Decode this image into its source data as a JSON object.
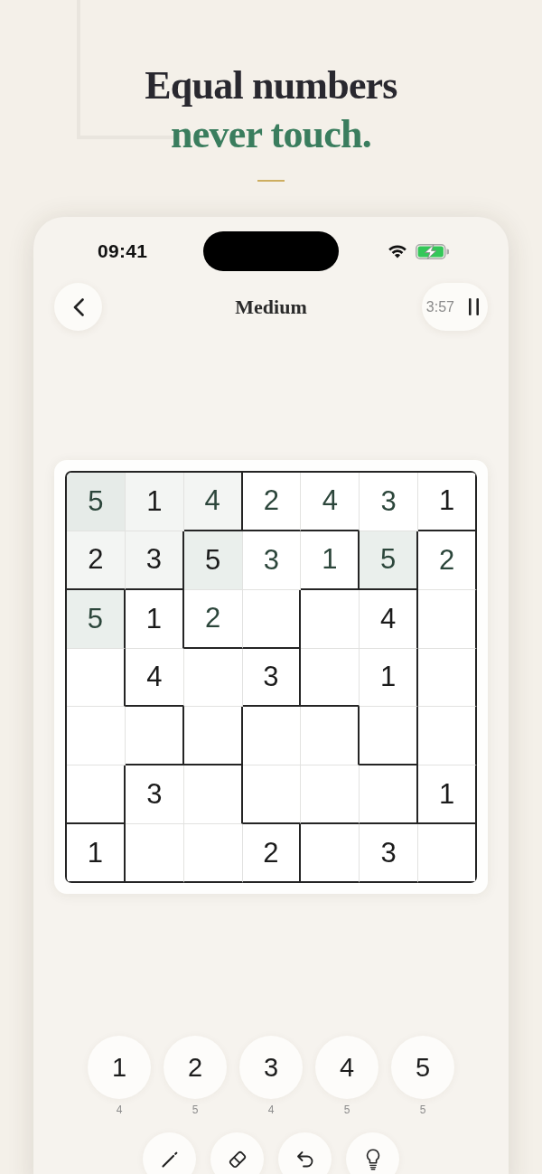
{
  "headline": {
    "line_1": "Equal numbers",
    "line_2": "never touch."
  },
  "status_bar": {
    "time": "09:41"
  },
  "nav": {
    "title": "Medium",
    "timer": "3:57"
  },
  "grid": {
    "rows": [
      [
        {
          "value": "5",
          "given": false,
          "same_number": true,
          "in_region": true,
          "wall_right": false,
          "wall_bottom": false
        },
        {
          "value": "1",
          "given": true,
          "same_number": false,
          "in_region": true,
          "wall_right": false,
          "wall_bottom": false
        },
        {
          "value": "4",
          "given": false,
          "same_number": false,
          "in_region": true,
          "wall_right": true,
          "wall_bottom": true
        },
        {
          "value": "2",
          "given": false,
          "same_number": false,
          "in_region": false,
          "wall_right": false,
          "wall_bottom": true
        },
        {
          "value": "4",
          "given": false,
          "same_number": false,
          "in_region": false,
          "wall_right": false,
          "wall_bottom": true
        },
        {
          "value": "3",
          "given": false,
          "same_number": false,
          "in_region": false,
          "wall_right": false,
          "wall_bottom": false
        },
        {
          "value": "1",
          "given": true,
          "same_number": false,
          "in_region": false,
          "wall_right": true,
          "wall_bottom": true
        }
      ],
      [
        {
          "value": "2",
          "given": true,
          "same_number": false,
          "in_region": true,
          "wall_right": false,
          "wall_bottom": true
        },
        {
          "value": "3",
          "given": true,
          "same_number": false,
          "in_region": true,
          "wall_right": true,
          "wall_bottom": true
        },
        {
          "value": "5",
          "given": true,
          "same_number": true,
          "in_region": false,
          "wall_right": false,
          "wall_bottom": false
        },
        {
          "value": "3",
          "given": false,
          "same_number": false,
          "in_region": false,
          "wall_right": false,
          "wall_bottom": false
        },
        {
          "value": "1",
          "given": false,
          "same_number": false,
          "in_region": false,
          "wall_right": true,
          "wall_bottom": true
        },
        {
          "value": "5",
          "given": false,
          "same_number": true,
          "in_region": false,
          "wall_right": true,
          "wall_bottom": true
        },
        {
          "value": "2",
          "given": false,
          "same_number": false,
          "in_region": false,
          "wall_right": true,
          "wall_bottom": false
        }
      ],
      [
        {
          "value": "5",
          "given": false,
          "same_number": true,
          "in_region": false,
          "wall_right": true,
          "wall_bottom": false
        },
        {
          "value": "1",
          "given": true,
          "same_number": false,
          "in_region": false,
          "wall_right": true,
          "wall_bottom": false
        },
        {
          "value": "2",
          "given": false,
          "same_number": false,
          "in_region": false,
          "wall_right": false,
          "wall_bottom": true
        },
        {
          "same_number": false,
          "in_region": false,
          "wall_right": true,
          "wall_bottom": true
        },
        {
          "same_number": false,
          "in_region": false,
          "wall_right": false,
          "wall_bottom": false
        },
        {
          "value": "4",
          "given": true,
          "same_number": false,
          "in_region": false,
          "wall_right": true,
          "wall_bottom": false
        },
        {
          "same_number": false,
          "in_region": false,
          "wall_right": true,
          "wall_bottom": false
        }
      ],
      [
        {
          "same_number": false,
          "in_region": false,
          "wall_right": true,
          "wall_bottom": false
        },
        {
          "value": "4",
          "given": true,
          "same_number": false,
          "in_region": false,
          "wall_right": false,
          "wall_bottom": true
        },
        {
          "same_number": false,
          "in_region": false,
          "wall_right": false,
          "wall_bottom": false
        },
        {
          "value": "3",
          "given": true,
          "same_number": false,
          "in_region": false,
          "wall_right": true,
          "wall_bottom": true
        },
        {
          "same_number": false,
          "in_region": false,
          "wall_right": false,
          "wall_bottom": true
        },
        {
          "value": "1",
          "given": true,
          "same_number": false,
          "in_region": false,
          "wall_right": true,
          "wall_bottom": false
        },
        {
          "same_number": false,
          "in_region": false,
          "wall_right": true,
          "wall_bottom": false
        }
      ],
      [
        {
          "same_number": false,
          "in_region": false,
          "wall_right": false,
          "wall_bottom": false
        },
        {
          "same_number": false,
          "in_region": false,
          "wall_right": true,
          "wall_bottom": true
        },
        {
          "same_number": false,
          "in_region": false,
          "wall_right": true,
          "wall_bottom": true
        },
        {
          "same_number": false,
          "in_region": false,
          "wall_right": false,
          "wall_bottom": false
        },
        {
          "same_number": false,
          "in_region": false,
          "wall_right": true,
          "wall_bottom": false
        },
        {
          "same_number": false,
          "in_region": false,
          "wall_right": true,
          "wall_bottom": true
        },
        {
          "same_number": false,
          "in_region": false,
          "wall_right": true,
          "wall_bottom": false
        }
      ],
      [
        {
          "same_number": false,
          "in_region": false,
          "wall_right": true,
          "wall_bottom": true
        },
        {
          "value": "3",
          "given": true,
          "same_number": false,
          "in_region": false,
          "wall_right": false,
          "wall_bottom": false
        },
        {
          "same_number": false,
          "in_region": false,
          "wall_right": true,
          "wall_bottom": false
        },
        {
          "same_number": false,
          "in_region": false,
          "wall_right": false,
          "wall_bottom": true
        },
        {
          "same_number": false,
          "in_region": false,
          "wall_right": false,
          "wall_bottom": true
        },
        {
          "same_number": false,
          "in_region": false,
          "wall_right": true,
          "wall_bottom": true
        },
        {
          "value": "1",
          "given": true,
          "same_number": false,
          "in_region": false,
          "wall_right": true,
          "wall_bottom": true
        }
      ],
      [
        {
          "value": "1",
          "given": true,
          "same_number": false,
          "in_region": false,
          "wall_right": true,
          "wall_bottom": true
        },
        {
          "same_number": false,
          "in_region": false,
          "wall_right": false,
          "wall_bottom": true
        },
        {
          "same_number": false,
          "in_region": false,
          "wall_right": false,
          "wall_bottom": true
        },
        {
          "value": "2",
          "given": true,
          "same_number": false,
          "in_region": false,
          "wall_right": true,
          "wall_bottom": true
        },
        {
          "same_number": false,
          "in_region": false,
          "wall_right": false,
          "wall_bottom": true
        },
        {
          "value": "3",
          "given": true,
          "same_number": false,
          "in_region": false,
          "wall_right": false,
          "wall_bottom": true
        },
        {
          "same_number": false,
          "in_region": false,
          "wall_right": true,
          "wall_bottom": true
        }
      ]
    ]
  },
  "numpad": [
    {
      "digit": "1",
      "count": "4"
    },
    {
      "digit": "2",
      "count": "5"
    },
    {
      "digit": "3",
      "count": "4"
    },
    {
      "digit": "4",
      "count": "5"
    },
    {
      "digit": "5",
      "count": "5"
    }
  ],
  "tools": [
    {
      "kind": "pencil"
    },
    {
      "kind": "eraser"
    },
    {
      "kind": "undo"
    },
    {
      "kind": "hint"
    }
  ]
}
